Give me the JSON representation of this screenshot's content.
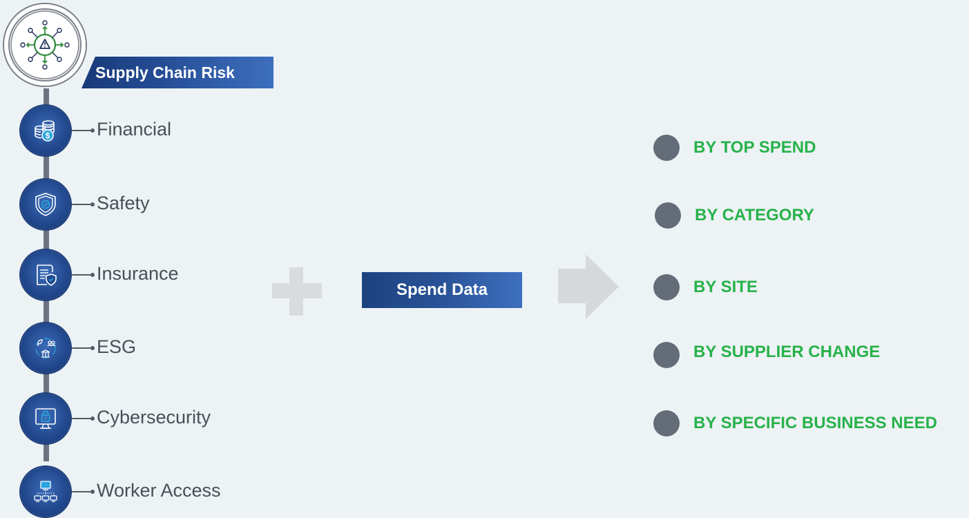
{
  "header": {
    "title": "Supply Chain Risk",
    "icon": "supply-network-alert-icon"
  },
  "risk_items": [
    {
      "label": "Financial",
      "icon": "coins-dollar-icon"
    },
    {
      "label": "Safety",
      "icon": "shield-check-icon"
    },
    {
      "label": "Insurance",
      "icon": "document-shield-icon"
    },
    {
      "label": "ESG",
      "icon": "leaf-people-building-icon"
    },
    {
      "label": "Cybersecurity",
      "icon": "monitor-lock-icon"
    },
    {
      "label": "Worker Access",
      "icon": "network-computers-icon"
    }
  ],
  "combine": {
    "label": "Spend Data",
    "operator_icon": "plus-icon",
    "arrow_icon": "arrow-right-icon"
  },
  "outputs": [
    "BY TOP SPEND",
    "BY CATEGORY",
    "BY SITE",
    "BY SUPPLIER CHANGE",
    "BY SPECIFIC BUSINESS NEED"
  ],
  "colors": {
    "background": "#edf2f5",
    "primary_blue": "#21478c",
    "output_green": "#27b24a",
    "bullet_gray": "#646c78",
    "connector_gray": "#6b7280"
  }
}
